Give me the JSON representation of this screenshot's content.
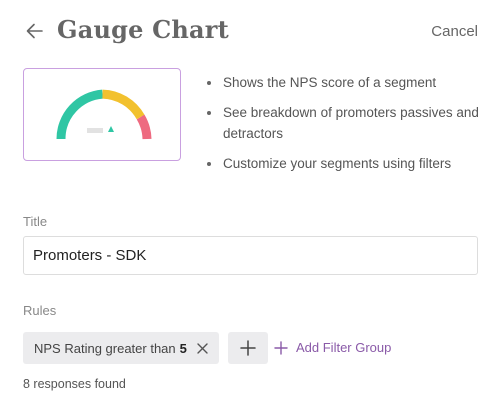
{
  "header": {
    "title": "Gauge Chart",
    "cancel_label": "Cancel"
  },
  "preview": {
    "gauge_colors": [
      "#2fc6a4",
      "#f2c12e",
      "#ee6a80"
    ]
  },
  "features": [
    "Shows the NPS score of a segment",
    "See breakdown of promoters passives and detractors",
    "Customize your segments using filters"
  ],
  "form": {
    "title_label": "Title",
    "title_value": "Promoters - SDK",
    "rules_label": "Rules",
    "rule_chip": {
      "text": "NPS Rating greater than",
      "value": "5"
    },
    "add_filter_group_label": "Add Filter Group",
    "responses_text": "8 responses found"
  },
  "colors": {
    "accent": "#8a5aa8",
    "preview_border": "#c9a0e0"
  }
}
